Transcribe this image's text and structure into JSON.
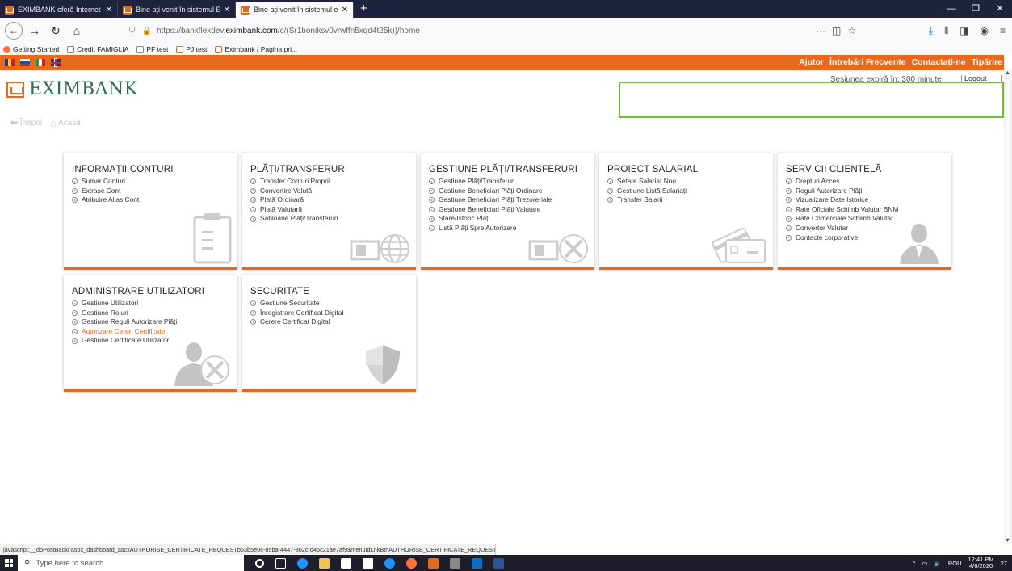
{
  "browser": {
    "tabs": [
      {
        "label": "EXIMBANK oferă Internet Banki",
        "active": false
      },
      {
        "label": "Bine ați venit în sistemul Exim",
        "active": false
      },
      {
        "label": "Bine ați venit în sistemul exim",
        "active": true
      }
    ],
    "new_tab": "+",
    "close": "✕",
    "url_prefix": "https://bankflexdev.",
    "url_host": "eximbank.com",
    "url_path": "/c/(S(1boniksv0vrwffn5xqd4t25k))/home",
    "url_more": "···",
    "bookmarks": [
      "Getting Started",
      "Credit FAMIGLIA",
      "PF test",
      "PJ test",
      "Eximbank / Pagina pri..."
    ]
  },
  "topbar": {
    "links": [
      "Ajutor",
      "Întrebări Frecvente",
      "Contactați-ne",
      "Tipărire"
    ],
    "flags": [
      "ro",
      "ru",
      "it",
      "uk"
    ]
  },
  "header": {
    "logo": "EXIMBANK",
    "session": "Sesiunea expiră în: 300 minute",
    "logout": "Logout"
  },
  "subnav": {
    "back": "Înapoi",
    "home": "Acasă"
  },
  "tiles": [
    {
      "title": "INFORMAȚII CONTURI",
      "items": [
        "Sumar Conturi",
        "Extrase Cont",
        "Atribuire Alias Cont"
      ],
      "icon": "clipboard-icon"
    },
    {
      "title": "PLĂȚI/TRANSFERURI",
      "items": [
        "Transfer Conturi Proprii",
        "Convertire Valută",
        "Plată Ordinară",
        "Plată Valutară",
        "Șabloane Plăți/Transferuri"
      ],
      "icon": "money-globe-icon"
    },
    {
      "title": "GESTIUNE PLĂȚI/TRANSFERURI",
      "items": [
        "Gestiune Plăți/Transferuri",
        "Gestiune Beneficiari Plăți Ordinare",
        "Gestiune Beneficiari Plăți Trezoreriale",
        "Gestiune Beneficiari Plăți Valutare",
        "Stare/Istoric Plăți",
        "Listă Plăți Spre Autorizare"
      ],
      "icon": "money-tools-icon"
    },
    {
      "title": "PROIECT SALARIAL",
      "items": [
        "Setare Salariat Nou",
        "Gestiune Listă Salariați",
        "Transfer Salarii"
      ],
      "icon": "cards-icon"
    },
    {
      "title": "SERVICII CLIENTELĂ",
      "items": [
        "Drepturi Acces",
        "Reguli Autorizare Plăți",
        "Vizualizare Date Istorice",
        "Rate Oficiale Schimb Valutar BNM",
        "Rate Comerciale Schimb Valutar",
        "Convertor Valutar",
        "Contacte corporative"
      ],
      "icon": "person-icon"
    },
    {
      "title": "ADMINISTRARE UTILIZATORI",
      "items": [
        "Gestiune Utilizatori",
        "Gestiune Roluri",
        "Gestiune Reguli Autorizare Plăți",
        "Autorizare Cereri Certificate",
        "Gestiune Certificate Utilizatori"
      ],
      "highlight": 3,
      "icon": "user-tools-icon"
    },
    {
      "title": "SECURITATE",
      "items": [
        "Gestiune Securitate",
        "Înregistrare Certificat Digital",
        "Cerere Certificat Digital"
      ],
      "icon": "shield-icon"
    }
  ],
  "statusbar": "javascript:__doPostBack('aspx_dashboard_ascxAUTHORISE_CERTIFICATE_REQUESTb63b5e0c-85ba-4447-802c-d45c21ae7af9$menuIdLnkBtnAUTHORISE_CERTIFICATE_REQUEST','')",
  "taskbar": {
    "search_placeholder": "Type here to search",
    "lang": "ROU",
    "time": "12:41 PM",
    "date": "4/6/2020",
    "notif_count": "27"
  },
  "colors": {
    "accent": "#e8691e",
    "brand_green": "#2b6e4a",
    "highlight_border": "#6dbf3a"
  }
}
